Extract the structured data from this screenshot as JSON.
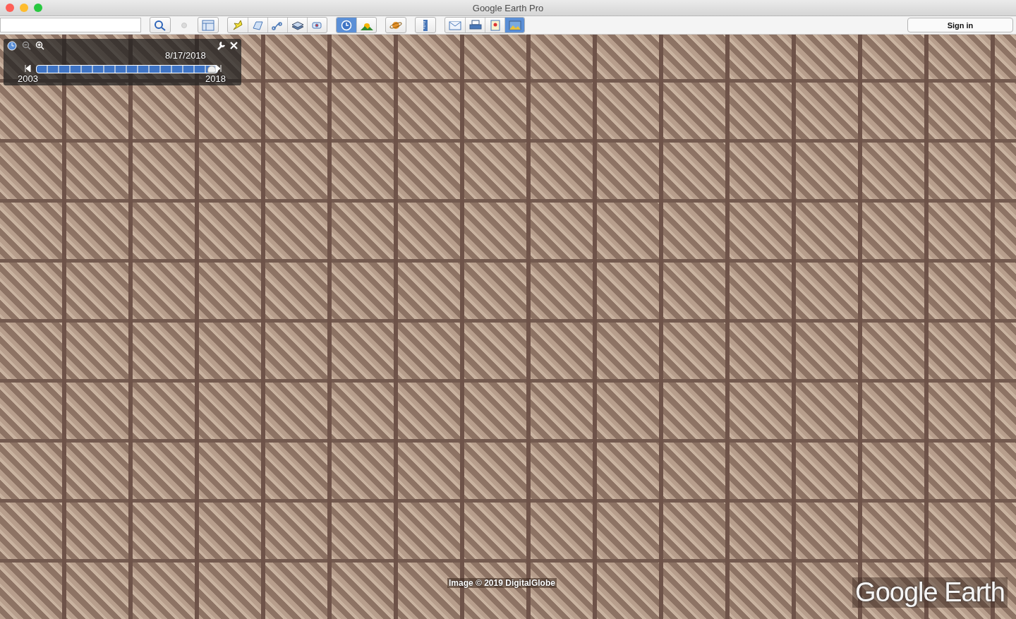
{
  "window": {
    "title": "Google Earth Pro"
  },
  "toolbar": {
    "groups": [
      [
        {
          "selected": false
        }
      ],
      [
        {
          "selected": false
        }
      ],
      [
        {
          "selected": false
        }
      ],
      [
        {
          "selected": false
        },
        {
          "selected": false
        },
        {
          "selected": false
        },
        {
          "selected": false
        },
        {
          "selected": false
        }
      ],
      [
        {
          "selected": true
        },
        {
          "selected": false
        }
      ],
      [
        {
          "selected": false
        }
      ],
      [
        {
          "selected": false
        }
      ],
      [
        {
          "selected": false
        },
        {
          "selected": false
        },
        {
          "selected": false
        },
        {
          "selected": true
        }
      ]
    ],
    "sign_in": "Sign in"
  },
  "time_slider": {
    "date": "8/17/2018",
    "start": "2003",
    "end": "2018",
    "level": 0.97
  },
  "map": {
    "attribution": "Image © 2019 DigitalGlobe",
    "logo": "Google Earth"
  }
}
